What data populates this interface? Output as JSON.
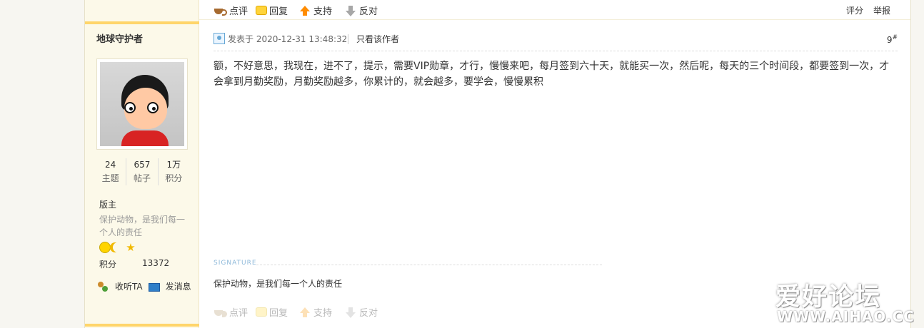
{
  "top_actions": [
    "点评",
    "回复",
    "支持",
    "反对"
  ],
  "top_right": [
    "评分",
    "举报"
  ],
  "author": {
    "name": "地球守护者",
    "stats": [
      {
        "num": "24",
        "label": "主题"
      },
      {
        "num": "657",
        "label": "帖子"
      },
      {
        "num": "1万",
        "label": "积分"
      }
    ],
    "rank": "版主",
    "motto": "保护动物，是我们每一个人的责任",
    "points_label": "积分",
    "points_value": "13372",
    "contact": [
      "收听TA",
      "发消息"
    ]
  },
  "post": {
    "time": "发表于 2020-12-31 13:48:32",
    "only_author": "只看该作者",
    "floor": "9",
    "floor_mark": "#",
    "content": "额，不好意思，我现在，进不了，提示，需要VIP勋章，才行，慢慢来吧，每月签到六十天，就能买一次，然后呢，每天的三个时间段，都要签到一次，才会拿到月勤奖励，月勤奖励越多，你累计的，就会越多，要学会，慢慢累积",
    "signature_label": "SIGNATURE",
    "signature": "保护动物，是我们每一个人的责任"
  },
  "bottom_actions": [
    "点评",
    "回复",
    "支持",
    "反对"
  ],
  "watermark": {
    "line1": "爱好论坛",
    "line2": "WWW.AIHAO.CC"
  }
}
